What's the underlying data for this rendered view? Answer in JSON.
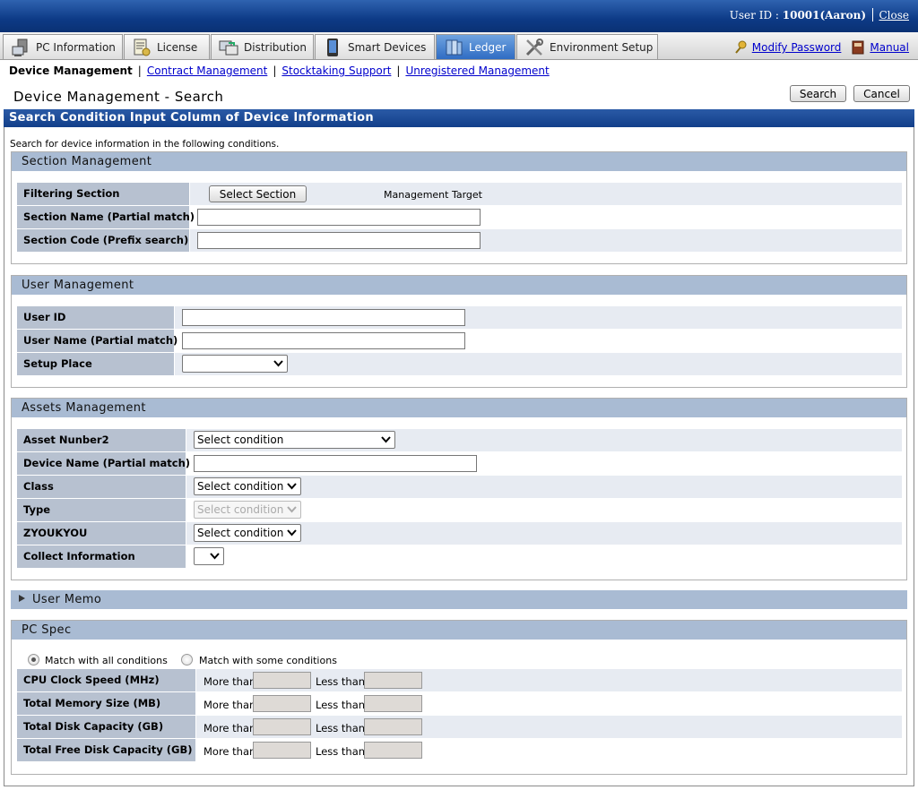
{
  "header": {
    "user_id_label": "User ID : ",
    "user_id_value": "10001(Aaron)",
    "close_label": "Close"
  },
  "tabs": [
    {
      "label": "PC Information",
      "icon": "pc-icon"
    },
    {
      "label": "License",
      "icon": "license-icon"
    },
    {
      "label": "Distribution",
      "icon": "distribution-icon"
    },
    {
      "label": "Smart Devices",
      "icon": "smart-device-icon"
    },
    {
      "label": "Ledger",
      "icon": "ledger-icon",
      "active": true
    },
    {
      "label": "Environment Setup",
      "icon": "tools-icon"
    }
  ],
  "right_links": {
    "modify_password": "Modify Password",
    "manual": "Manual"
  },
  "subnav": {
    "current": "Device Management",
    "links": [
      "Contract Management",
      "Stocktaking Support",
      "Unregistered Management"
    ]
  },
  "page": {
    "title": "Device Management - Search",
    "search_button": "Search",
    "cancel_button": "Cancel"
  },
  "main": {
    "header": "Search Condition Input Column of Device Information",
    "note": "Search for device information in the following conditions."
  },
  "section_mgmt": {
    "title": "Section Management",
    "filtering_label": "Filtering Section",
    "select_section_button": "Select Section",
    "management_target": "Management Target",
    "section_name_label": "Section Name (Partial match)",
    "section_code_label": "Section Code (Prefix search)"
  },
  "user_mgmt": {
    "title": "User Management",
    "user_id_label": "User ID",
    "user_name_label": "User Name (Partial match)",
    "setup_place_label": "Setup Place"
  },
  "assets_mgmt": {
    "title": "Assets Management",
    "asset_number_label": "Asset Nunber2",
    "asset_number_value": "Select condition",
    "device_name_label": "Device Name (Partial match)",
    "class_label": "Class",
    "class_value": "Select condition",
    "type_label": "Type",
    "type_value": "Select condition",
    "zyoukyou_label": "ZYOUKYOU",
    "zyoukyou_value": "Select condition",
    "collect_label": "Collect Information"
  },
  "user_memo": {
    "title": "User Memo"
  },
  "pc_spec": {
    "title": "PC Spec",
    "match_all": "Match with all conditions",
    "match_some": "Match with some conditions",
    "more_than": "More than",
    "less_than": "Less than",
    "rows": [
      "CPU Clock Speed (MHz)",
      "Total Memory Size (MB)",
      "Total Disk Capacity (GB)",
      "Total Free Disk Capacity (GB)"
    ]
  }
}
